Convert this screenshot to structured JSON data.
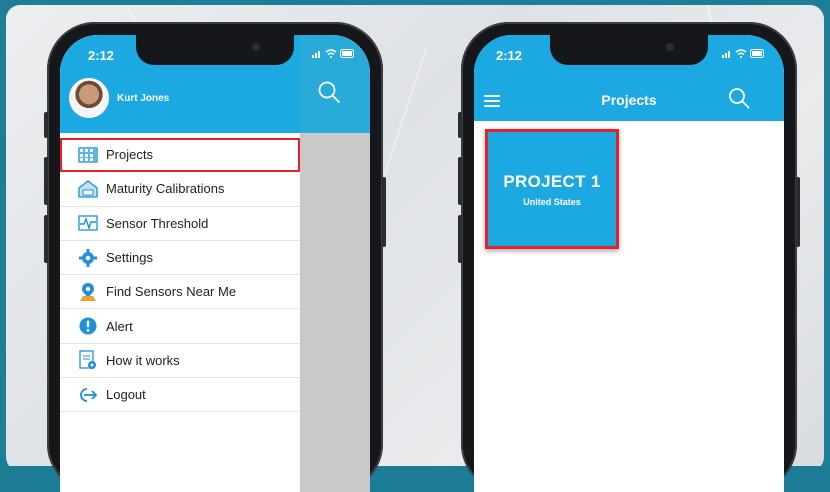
{
  "left_phone": {
    "status_time": "2:12",
    "user_name": "Kurt Jones",
    "menu": [
      {
        "label": "Projects",
        "icon": "projects-grid-icon",
        "selected": true
      },
      {
        "label": "Maturity Calibrations",
        "icon": "maturity-calibrations-icon",
        "selected": false
      },
      {
        "label": "Sensor Threshold",
        "icon": "sensor-threshold-icon",
        "selected": false
      },
      {
        "label": "Settings",
        "icon": "gear-icon",
        "selected": false
      },
      {
        "label": "Find Sensors Near Me",
        "icon": "location-pin-icon",
        "selected": false
      },
      {
        "label": "Alert",
        "icon": "alert-icon",
        "selected": false
      },
      {
        "label": "How it works",
        "icon": "how-it-works-icon",
        "selected": false
      },
      {
        "label": "Logout",
        "icon": "logout-icon",
        "selected": false
      }
    ]
  },
  "right_phone": {
    "status_time": "2:12",
    "title": "Projects",
    "project": {
      "name": "PROJECT 1",
      "country": "United States"
    }
  },
  "colors": {
    "brand_blue": "#1ca9e1",
    "highlight_red": "#e8202a",
    "icon_blue": "#1f8fd6",
    "footer_teal": "#1c7b95"
  }
}
